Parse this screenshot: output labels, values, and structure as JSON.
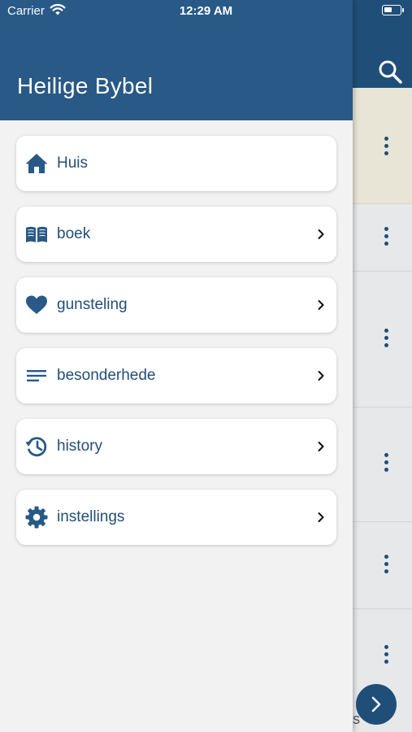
{
  "status_bar": {
    "carrier": "Carrier",
    "time": "12:29 AM",
    "battery_level": 0.5
  },
  "drawer": {
    "title": "Heilige Bybel",
    "items": [
      {
        "label": "Huis",
        "icon": "home-icon",
        "has_chevron": false
      },
      {
        "label": "boek",
        "icon": "book-open-icon",
        "has_chevron": true
      },
      {
        "label": "gunsteling",
        "icon": "heart-icon",
        "has_chevron": true
      },
      {
        "label": "besonderhede",
        "icon": "lines-icon",
        "has_chevron": true
      },
      {
        "label": "history",
        "icon": "history-icon",
        "has_chevron": true
      },
      {
        "label": "instellings",
        "icon": "gear-icon",
        "has_chevron": true
      }
    ]
  },
  "background": {
    "partial_text": "s"
  },
  "colors": {
    "primary": "#285987",
    "header_dark": "#1f4f78",
    "drawer_bg": "#f2f2f3",
    "menu_text": "#244e78"
  }
}
